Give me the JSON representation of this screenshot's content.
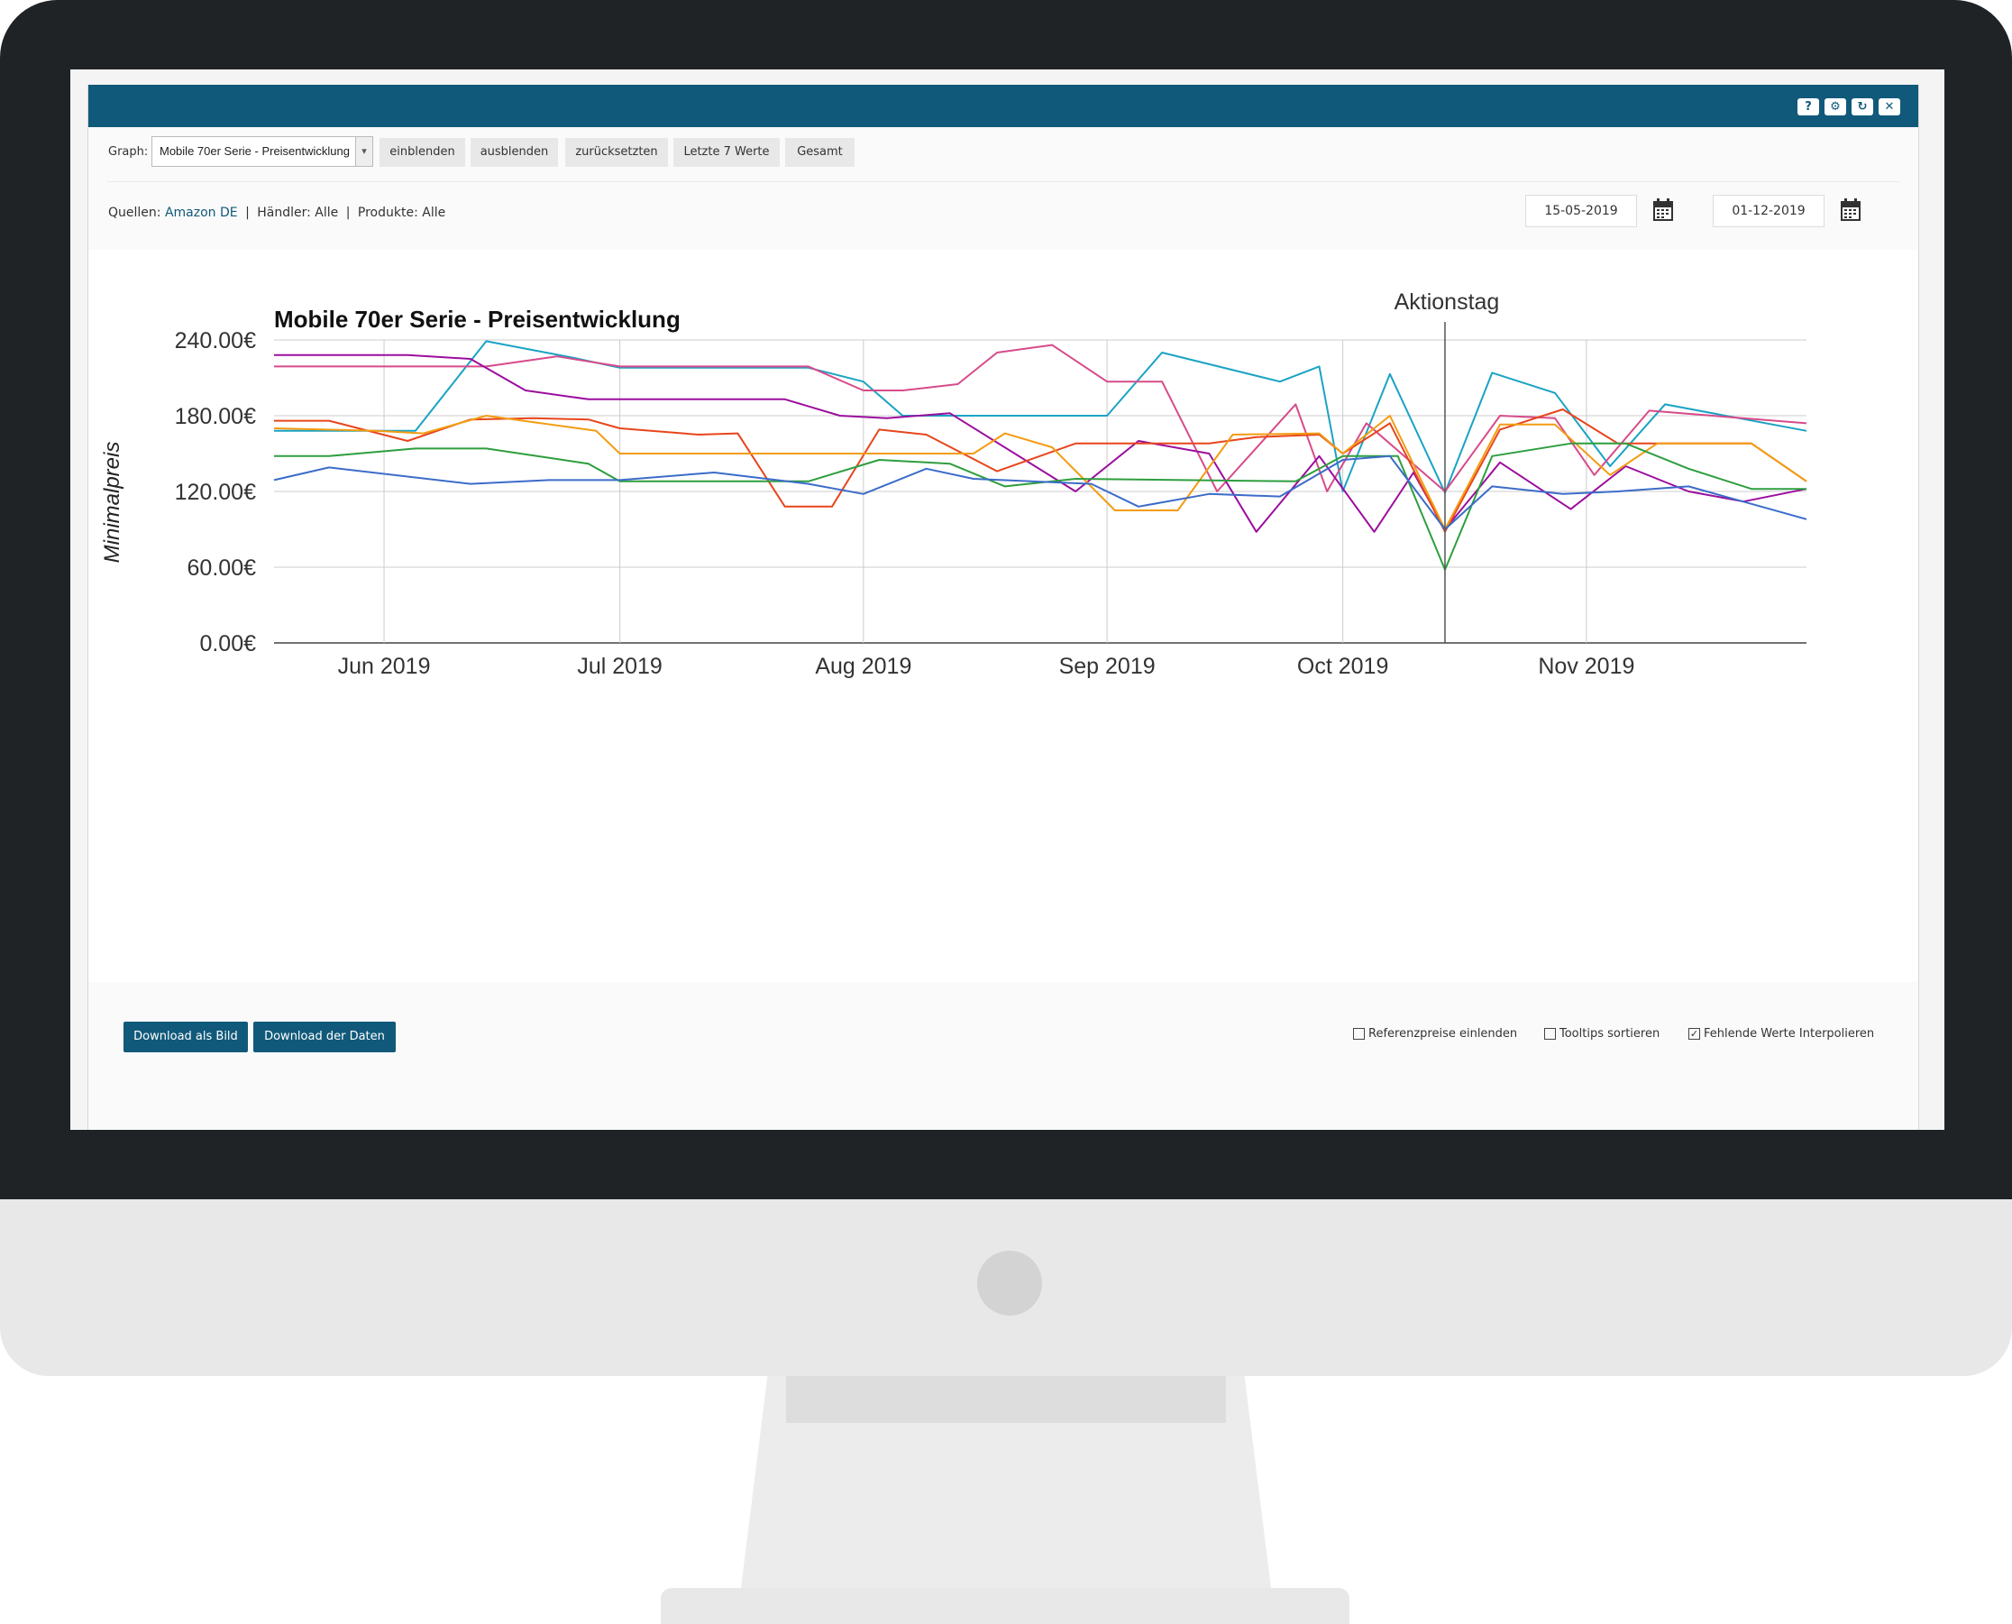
{
  "toolbar": {
    "graph_label": "Graph:",
    "graph_select": "Mobile 70er Serie - Preisentwicklung",
    "buttons": [
      "einblenden",
      "ausblenden",
      "zurücksetzten",
      "Letzte 7 Werte",
      "Gesamt"
    ]
  },
  "filters": {
    "sources_label": "Quellen:",
    "sources_value": "Amazon DE",
    "sep": "|",
    "dealers": "Händler: Alle",
    "products": "Produkte: Alle",
    "date_from": "15-05-2019",
    "date_to": "01-12-2019"
  },
  "titlebar_icons": [
    "help-icon",
    "gear-icon",
    "refresh-icon",
    "close-icon"
  ],
  "bottom": {
    "download_image": "Download als Bild",
    "download_data": "Download der Daten",
    "checkboxes": [
      {
        "label": "Referenzpreise einlenden",
        "checked": false
      },
      {
        "label": "Tooltips sortieren",
        "checked": false
      },
      {
        "label": "Fehlende Werte Interpolieren",
        "checked": true
      }
    ]
  },
  "chart_data": {
    "type": "line",
    "title": "Mobile 70er Serie - Preisentwicklung",
    "ylabel": "Minimalpreis",
    "ylim": [
      0,
      240
    ],
    "yticks": [
      "0.00€",
      "60.00€",
      "120.00€",
      "180.00€",
      "240.00€"
    ],
    "xlim": [
      "2019-05-18",
      "2019-11-29"
    ],
    "xticks": [
      {
        "date": "2019-06-01",
        "label": "Jun 2019"
      },
      {
        "date": "2019-07-01",
        "label": "Jul 2019"
      },
      {
        "date": "2019-08-01",
        "label": "Aug 2019"
      },
      {
        "date": "2019-09-01",
        "label": "Sep 2019"
      },
      {
        "date": "2019-10-01",
        "label": "Oct 2019"
      },
      {
        "date": "2019-11-01",
        "label": "Nov 2019"
      }
    ],
    "annotation": {
      "date": "2019-10-14",
      "label": "Aktionstag"
    },
    "grid": true,
    "series": [
      {
        "color": "#1aa3c4",
        "points": [
          [
            "2019-05-18",
            168
          ],
          [
            "2019-05-31",
            168
          ],
          [
            "2019-06-05",
            168
          ],
          [
            "2019-06-14",
            239
          ],
          [
            "2019-06-25",
            226
          ],
          [
            "2019-07-01",
            218
          ],
          [
            "2019-07-25",
            218
          ],
          [
            "2019-08-01",
            207
          ],
          [
            "2019-08-06",
            180
          ],
          [
            "2019-08-15",
            180
          ],
          [
            "2019-09-01",
            180
          ],
          [
            "2019-09-08",
            230
          ],
          [
            "2019-09-23",
            207
          ],
          [
            "2019-09-28",
            219
          ],
          [
            "2019-10-01",
            120
          ],
          [
            "2019-10-07",
            213
          ],
          [
            "2019-10-14",
            119
          ],
          [
            "2019-10-20",
            214
          ],
          [
            "2019-10-28",
            198
          ],
          [
            "2019-11-04",
            140
          ],
          [
            "2019-11-11",
            189
          ],
          [
            "2019-11-29",
            168
          ]
        ]
      },
      {
        "color": "#d64b8a",
        "points": [
          [
            "2019-05-18",
            219
          ],
          [
            "2019-06-14",
            219
          ],
          [
            "2019-06-23",
            227
          ],
          [
            "2019-07-01",
            219
          ],
          [
            "2019-07-25",
            219
          ],
          [
            "2019-08-01",
            200
          ],
          [
            "2019-08-06",
            200
          ],
          [
            "2019-08-13",
            205
          ],
          [
            "2019-08-18",
            230
          ],
          [
            "2019-08-25",
            236
          ],
          [
            "2019-09-01",
            207
          ],
          [
            "2019-09-08",
            207
          ],
          [
            "2019-09-15",
            120
          ],
          [
            "2019-09-25",
            189
          ],
          [
            "2019-09-29",
            120
          ],
          [
            "2019-10-04",
            174
          ],
          [
            "2019-10-14",
            120
          ],
          [
            "2019-10-21",
            180
          ],
          [
            "2019-10-28",
            178
          ],
          [
            "2019-11-02",
            133
          ],
          [
            "2019-11-09",
            184
          ],
          [
            "2019-11-29",
            174
          ]
        ]
      },
      {
        "color": "#9b0e9e",
        "points": [
          [
            "2019-05-18",
            228
          ],
          [
            "2019-05-31",
            228
          ],
          [
            "2019-06-04",
            228
          ],
          [
            "2019-06-12",
            225
          ],
          [
            "2019-06-19",
            200
          ],
          [
            "2019-06-27",
            193
          ],
          [
            "2019-07-22",
            193
          ],
          [
            "2019-07-29",
            180
          ],
          [
            "2019-08-04",
            178
          ],
          [
            "2019-08-12",
            182
          ],
          [
            "2019-08-28",
            120
          ],
          [
            "2019-09-05",
            160
          ],
          [
            "2019-09-14",
            150
          ],
          [
            "2019-09-20",
            88
          ],
          [
            "2019-09-28",
            148
          ],
          [
            "2019-10-05",
            88
          ],
          [
            "2019-10-10",
            135
          ],
          [
            "2019-10-14",
            90
          ],
          [
            "2019-10-21",
            143
          ],
          [
            "2019-10-30",
            106
          ],
          [
            "2019-11-06",
            140
          ],
          [
            "2019-11-14",
            120
          ],
          [
            "2019-11-21",
            112
          ],
          [
            "2019-11-29",
            122
          ]
        ]
      },
      {
        "color": "#e8451c",
        "points": [
          [
            "2019-05-18",
            176
          ],
          [
            "2019-05-25",
            176
          ],
          [
            "2019-06-04",
            160
          ],
          [
            "2019-06-12",
            177
          ],
          [
            "2019-06-20",
            178
          ],
          [
            "2019-06-27",
            177
          ],
          [
            "2019-07-01",
            170
          ],
          [
            "2019-07-11",
            165
          ],
          [
            "2019-07-16",
            166
          ],
          [
            "2019-07-22",
            108
          ],
          [
            "2019-07-28",
            108
          ],
          [
            "2019-08-03",
            169
          ],
          [
            "2019-08-09",
            165
          ],
          [
            "2019-08-18",
            136
          ],
          [
            "2019-08-28",
            158
          ],
          [
            "2019-09-05",
            158
          ],
          [
            "2019-09-14",
            158
          ],
          [
            "2019-09-20",
            163
          ],
          [
            "2019-09-28",
            165
          ],
          [
            "2019-10-01",
            150
          ],
          [
            "2019-10-07",
            174
          ],
          [
            "2019-10-14",
            88
          ],
          [
            "2019-10-21",
            169
          ],
          [
            "2019-10-29",
            185
          ],
          [
            "2019-11-05",
            158
          ],
          [
            "2019-11-22",
            158
          ],
          [
            "2019-11-29",
            128
          ]
        ]
      },
      {
        "color": "#f39c12",
        "points": [
          [
            "2019-05-18",
            170
          ],
          [
            "2019-05-31",
            168
          ],
          [
            "2019-06-06",
            166
          ],
          [
            "2019-06-14",
            180
          ],
          [
            "2019-06-28",
            168
          ],
          [
            "2019-07-01",
            150
          ],
          [
            "2019-08-15",
            150
          ],
          [
            "2019-08-19",
            166
          ],
          [
            "2019-08-25",
            155
          ],
          [
            "2019-09-02",
            105
          ],
          [
            "2019-09-10",
            105
          ],
          [
            "2019-09-17",
            165
          ],
          [
            "2019-09-28",
            166
          ],
          [
            "2019-10-01",
            150
          ],
          [
            "2019-10-07",
            180
          ],
          [
            "2019-10-14",
            90
          ],
          [
            "2019-10-21",
            173
          ],
          [
            "2019-10-28",
            173
          ],
          [
            "2019-11-04",
            133
          ],
          [
            "2019-11-10",
            158
          ],
          [
            "2019-11-22",
            158
          ],
          [
            "2019-11-29",
            128
          ]
        ]
      },
      {
        "color": "#2e9e3e",
        "points": [
          [
            "2019-05-18",
            148
          ],
          [
            "2019-05-25",
            148
          ],
          [
            "2019-06-05",
            154
          ],
          [
            "2019-06-14",
            154
          ],
          [
            "2019-06-27",
            142
          ],
          [
            "2019-07-01",
            128
          ],
          [
            "2019-07-25",
            128
          ],
          [
            "2019-08-03",
            145
          ],
          [
            "2019-08-12",
            142
          ],
          [
            "2019-08-19",
            124
          ],
          [
            "2019-08-28",
            130
          ],
          [
            "2019-09-25",
            128
          ],
          [
            "2019-10-01",
            148
          ],
          [
            "2019-10-08",
            148
          ],
          [
            "2019-10-14",
            58
          ],
          [
            "2019-10-20",
            148
          ],
          [
            "2019-10-30",
            158
          ],
          [
            "2019-11-06",
            158
          ],
          [
            "2019-11-14",
            138
          ],
          [
            "2019-11-22",
            122
          ],
          [
            "2019-11-29",
            122
          ]
        ]
      },
      {
        "color": "#3b6cc9",
        "points": [
          [
            "2019-05-18",
            129
          ],
          [
            "2019-05-25",
            139
          ],
          [
            "2019-06-12",
            126
          ],
          [
            "2019-06-22",
            129
          ],
          [
            "2019-07-01",
            129
          ],
          [
            "2019-07-13",
            135
          ],
          [
            "2019-07-25",
            126
          ],
          [
            "2019-08-01",
            118
          ],
          [
            "2019-08-09",
            138
          ],
          [
            "2019-08-15",
            130
          ],
          [
            "2019-08-30",
            126
          ],
          [
            "2019-09-05",
            108
          ],
          [
            "2019-09-14",
            118
          ],
          [
            "2019-09-23",
            116
          ],
          [
            "2019-10-01",
            145
          ],
          [
            "2019-10-07",
            148
          ],
          [
            "2019-10-14",
            90
          ],
          [
            "2019-10-20",
            124
          ],
          [
            "2019-10-29",
            118
          ],
          [
            "2019-11-05",
            120
          ],
          [
            "2019-11-14",
            124
          ],
          [
            "2019-11-29",
            98
          ]
        ]
      }
    ]
  }
}
